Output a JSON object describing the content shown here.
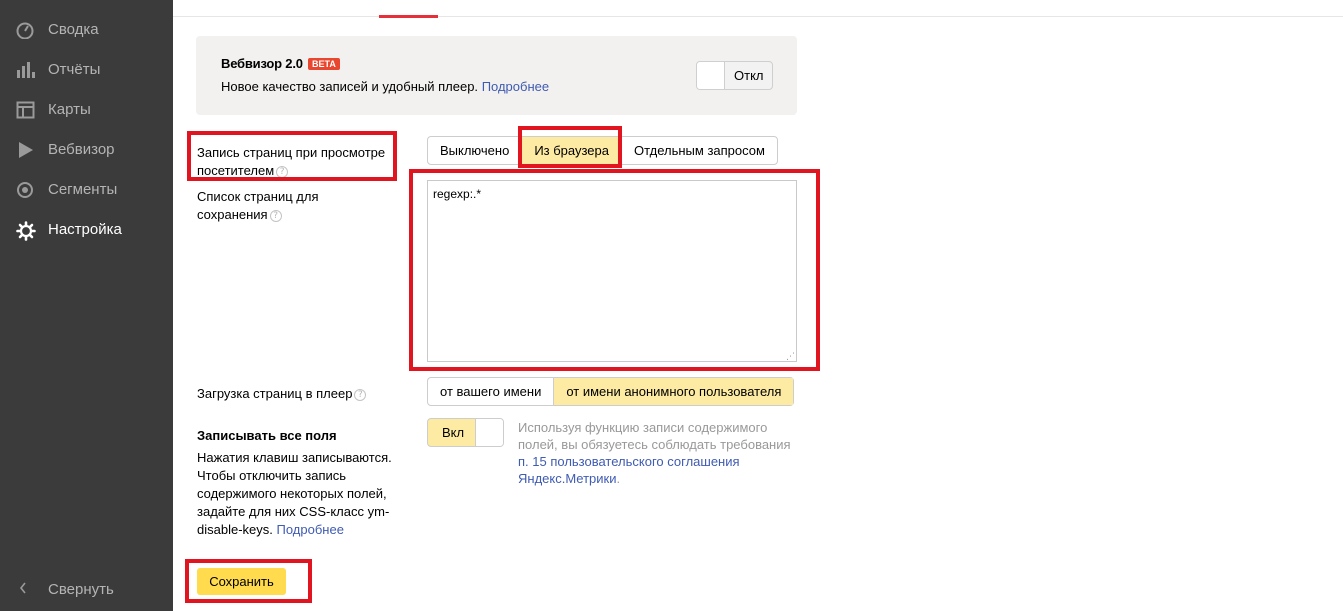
{
  "sidebar": {
    "items": [
      {
        "label": "Сводка",
        "icon": "gauge-icon"
      },
      {
        "label": "Отчёты",
        "icon": "bar-chart-icon"
      },
      {
        "label": "Карты",
        "icon": "map-grid-icon"
      },
      {
        "label": "Вебвизор",
        "icon": "play-icon"
      },
      {
        "label": "Сегменты",
        "icon": "segments-icon"
      },
      {
        "label": "Настройка",
        "icon": "gear-icon",
        "active": true
      }
    ],
    "collapse_label": "Свернуть",
    "collapse_icon": "chevron-left-icon"
  },
  "promo": {
    "title": "Вебвизор 2.0",
    "badge": "BETA",
    "text": "Новое качество записей и удобный плеер.",
    "link": "Подробнее",
    "toggle_label": "Откл",
    "toggle_state": "off"
  },
  "record_pages": {
    "label": "Запись страниц при просмотре посетителем",
    "options": [
      "Выключено",
      "Из браузера",
      "Отдельным запросом"
    ],
    "selected": "Из браузера"
  },
  "pages_list": {
    "label": "Список страниц для сохранения",
    "value": "regexp:.*"
  },
  "player_loading": {
    "label": "Загрузка страниц в плеер",
    "options": [
      "от вашего имени",
      "от имени анонимного пользователя"
    ],
    "selected": "от имени анонимного пользователя"
  },
  "record_fields": {
    "title": "Записывать все поля",
    "description": "Нажатия клавиш записываются. Чтобы отключить запись содержимого некоторых полей, задайте для них CSS-класс ym-disable-keys.",
    "link": "Подробнее",
    "toggle_label": "Вкл",
    "toggle_state": "on",
    "notice_text": "Используя функцию записи содержимого полей, вы обязуетесь соблюдать требования",
    "notice_link": "п. 15 пользовательского соглашения Яндекс.Метрики",
    "notice_end": "."
  },
  "save_label": "Сохранить",
  "colors": {
    "sidebar_bg": "#3b3b3b",
    "accent_yellow": "#ffdb4d",
    "selected_yellow": "#fdeba3",
    "highlight_red": "#e1151f",
    "link_blue": "#3f5bb2"
  }
}
